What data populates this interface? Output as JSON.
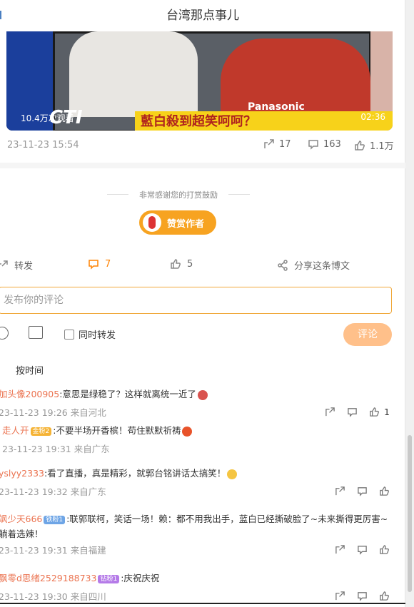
{
  "header": {
    "title": "台湾那点事儿"
  },
  "video": {
    "views": "10.4万次观看",
    "duration": "02:36",
    "brand": "Panasonic",
    "channel_logo": "CTI",
    "ticker": "藍白殺到超笑呵呵？"
  },
  "post_meta": {
    "date": "23-11-23 15:54",
    "share_count": "17",
    "comment_count": "163",
    "like_count": "1.1万"
  },
  "reward": {
    "thanks_text": "非常感谢您的打赏鼓励",
    "button_label": "赞赏作者"
  },
  "actions": {
    "forward_label": "转发",
    "comment_count": "7",
    "like_count": "5",
    "share_label": "分享这条博文"
  },
  "comment_input": {
    "placeholder": "发布你的评论",
    "forward_label": "同时转发",
    "submit_label": "评论"
  },
  "sort_label": "按时间",
  "comments": [
    {
      "user": "加头像200905",
      "badge": "",
      "text": ":意思是绿稳了？这样就离统一近了",
      "time": "23-11-23 19:26 来自河北",
      "like_count": "1"
    },
    {
      "user": "走人开",
      "badge": "金粉2",
      "text": ":不要半场开香槟！苟住默默祈祷",
      "time": "23-11-23 19:31 来自广东",
      "like_count": ""
    },
    {
      "user": "yslyy2333",
      "badge": "",
      "text": ":看了直播，真是精彩，就郭台铭讲话太搞笑！",
      "time": "23-11-23 19:32 来自广东",
      "like_count": ""
    },
    {
      "user": "飒少天666",
      "badge": "铁粉1",
      "text": ":联郭联柯，笑话一场！赖：都不用我出手，蓝白已经撕破脸了~未来撕得更厉害~躺着选辣！",
      "time": "23-11-23 19:31 来自福建",
      "like_count": ""
    },
    {
      "user": "飘零d思绪2529188733",
      "badge": "钻粉1",
      "text": ":庆祝庆祝",
      "time": "23-11-23 19:30 来自四川",
      "like_count": ""
    }
  ],
  "colors": {
    "accent": "#ff8200",
    "username": "#eb7350",
    "reward_bg": "#f7a321"
  }
}
